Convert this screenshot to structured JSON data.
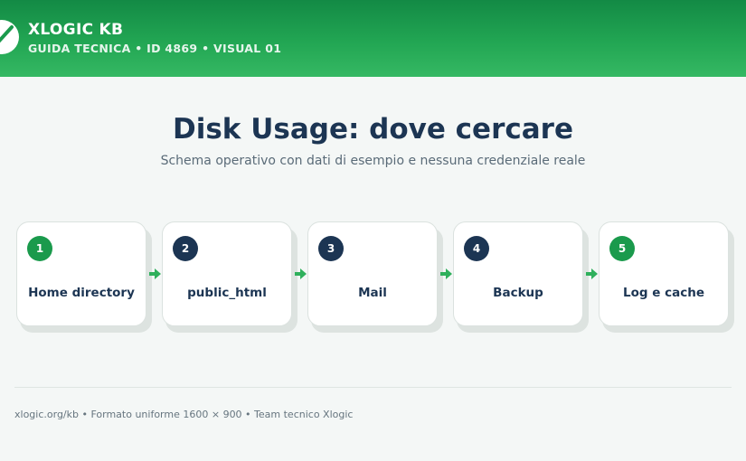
{
  "header": {
    "brand": "XLOGIC KB",
    "subtitle": "GUIDA TECNICA • ID 4869 • VISUAL 01",
    "logo_icon": "checkmark-icon"
  },
  "main": {
    "title": "Disk Usage: dove cercare",
    "subtitle": "Schema operativo con dati di esempio e nessuna credenziale reale"
  },
  "steps": [
    {
      "number": "1",
      "label": "Home directory",
      "badge_color": "#1a9a4c"
    },
    {
      "number": "2",
      "label": "public_html",
      "badge_color": "#1c3553"
    },
    {
      "number": "3",
      "label": "Mail",
      "badge_color": "#1c3553"
    },
    {
      "number": "4",
      "label": "Backup",
      "badge_color": "#1c3553"
    },
    {
      "number": "5",
      "label": "Log e cache",
      "badge_color": "#1a9a4c"
    }
  ],
  "connector_icon": "arrow-right-icon",
  "footer": {
    "text": "xlogic.org/kb • Formato uniforme 1600 × 900 • Team tecnico Xlogic"
  },
  "colors": {
    "header_green": "#22a653",
    "accent_green": "#1a9a4c",
    "navy": "#1c3553",
    "background": "#f4f7f6"
  }
}
